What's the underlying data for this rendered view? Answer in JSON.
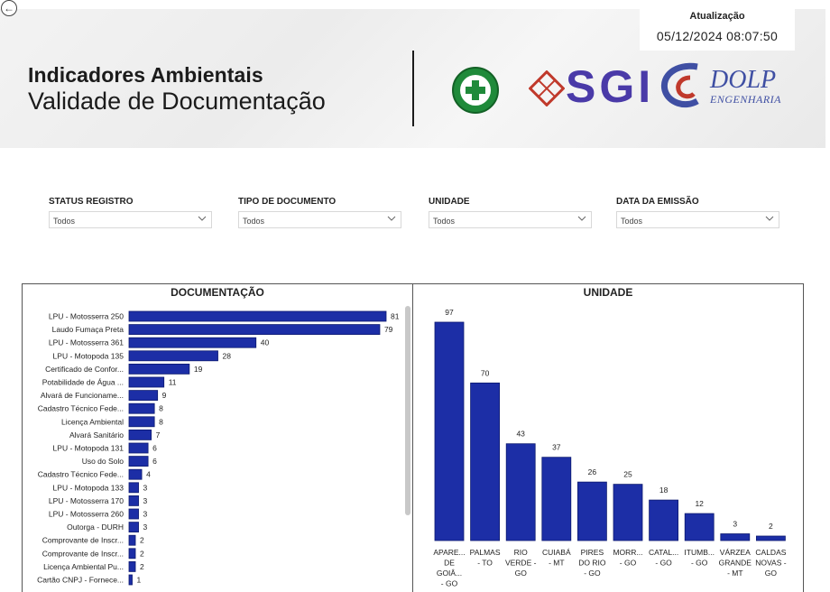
{
  "header": {
    "title_line1": "Indicadores Ambientais",
    "title_line2": "Validade de Documentação",
    "update_label": "Atualização",
    "update_value": "05/12/2024 08:07:50",
    "logos": {
      "sesmt": "sesmt-seguranca-logo",
      "sgi": "SGI",
      "dolp": "DOLP",
      "dolp_sub": "ENGENHARIA"
    }
  },
  "filters": [
    {
      "label": "STATUS REGISTRO",
      "value": "Todos"
    },
    {
      "label": "TIPO DE DOCUMENTO",
      "value": "Todos"
    },
    {
      "label": "UNIDADE",
      "value": "Todos"
    },
    {
      "label": "DATA DA EMISSÃO",
      "value": "Todos"
    }
  ],
  "colors": {
    "bar": "#1c2ea6",
    "bar_stroke": "#0d1a70"
  },
  "chart_data": [
    {
      "type": "bar",
      "orientation": "horizontal",
      "title": "DOCUMENTAÇÃO",
      "categories": [
        "LPU - Motosserra 250",
        "Laudo Fumaça Preta",
        "LPU - Motosserra 361",
        "LPU - Motopoda 135",
        "Certificado de Confor...",
        "Potabilidade de Água ...",
        "Alvará de Funcioname...",
        "Cadastro Técnico Fede...",
        "Licença Ambiental",
        "Alvará Sanitário",
        "LPU - Motopoda 131",
        "Uso do Solo",
        "Cadastro Técnico Fede...",
        "LPU - Motopoda 133",
        "LPU - Motosserra 170",
        "LPU - Motosserra 260",
        "Outorga - DURH",
        "Comprovante de Inscr...",
        "Comprovante de Inscr...",
        "Licença Ambiental Pu...",
        "Cartão CNPJ - Fornece..."
      ],
      "values": [
        81,
        79,
        40,
        28,
        19,
        11,
        9,
        8,
        8,
        7,
        6,
        6,
        4,
        3,
        3,
        3,
        3,
        2,
        2,
        2,
        1
      ]
    },
    {
      "type": "bar",
      "orientation": "vertical",
      "title": "UNIDADE",
      "categories": [
        [
          "APARE...",
          "DE",
          "GOIÂ...",
          "- GO"
        ],
        [
          "PALMAS",
          "- TO"
        ],
        [
          "RIO",
          "VERDE -",
          "GO"
        ],
        [
          "CUIABÁ",
          "- MT"
        ],
        [
          "PIRES",
          "DO RIO",
          "- GO"
        ],
        [
          "MORR...",
          "- GO"
        ],
        [
          "CATAL...",
          "- GO"
        ],
        [
          "ITUMB...",
          "- GO"
        ],
        [
          "VÁRZEA",
          "GRANDE",
          "- MT"
        ],
        [
          "CALDAS",
          "NOVAS -",
          "GO"
        ]
      ],
      "values": [
        97,
        70,
        43,
        37,
        26,
        25,
        18,
        12,
        3,
        2
      ]
    }
  ]
}
